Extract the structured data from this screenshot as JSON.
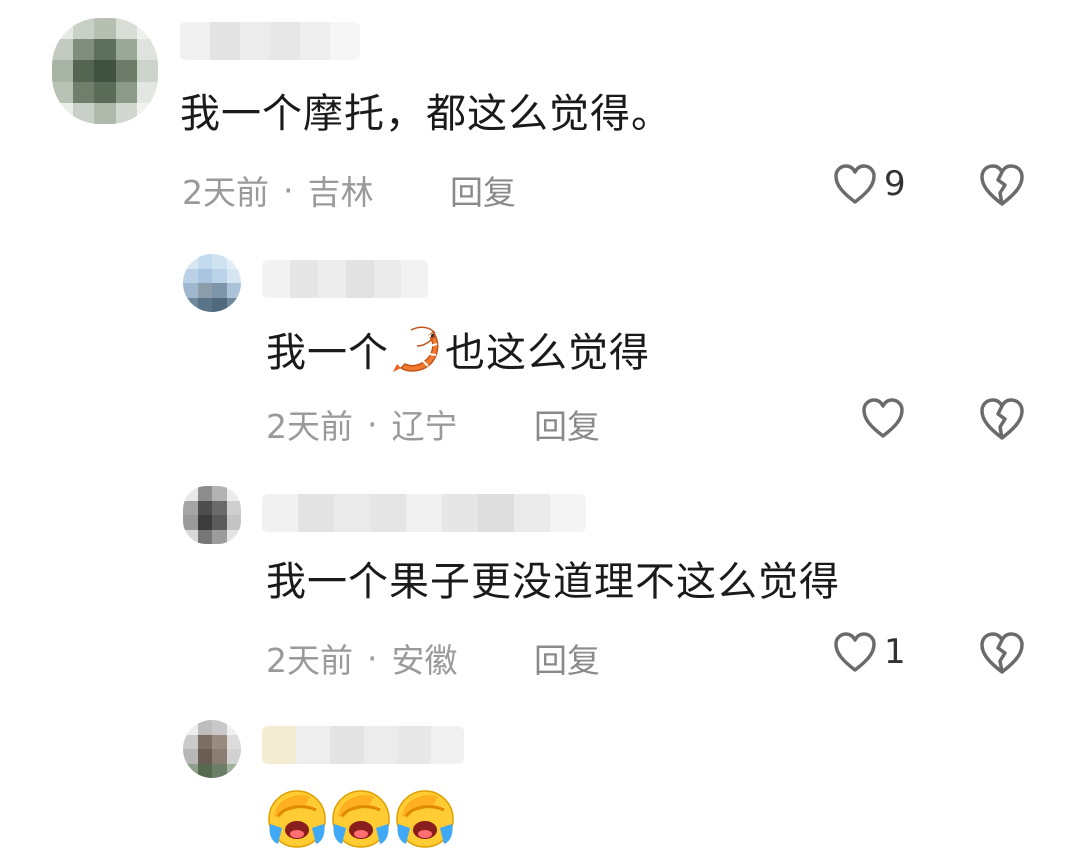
{
  "comments": [
    {
      "text": "我一个摩托，都这么觉得。",
      "time": "2天前",
      "separator": "·",
      "location": "吉林",
      "reply_label": "回复",
      "likes": "9"
    },
    {
      "text_before": "我一个",
      "emoji": "shrimp",
      "text_after": "也这么觉得",
      "time": "2天前",
      "separator": "·",
      "location": "辽宁",
      "reply_label": "回复",
      "likes": ""
    },
    {
      "text": "我一个果子更没道理不这么觉得",
      "time": "2天前",
      "separator": "·",
      "location": "安徽",
      "reply_label": "回复",
      "likes": "1"
    },
    {
      "emojis": [
        "face-palm-crying",
        "face-palm-crying",
        "face-palm-crying"
      ]
    }
  ],
  "icons": {
    "like": "heart-outline-icon",
    "dislike": "broken-heart-icon"
  },
  "colors": {
    "text": "#1a1a1a",
    "meta": "#9a9a9a",
    "icon": "#6b6b6b"
  }
}
